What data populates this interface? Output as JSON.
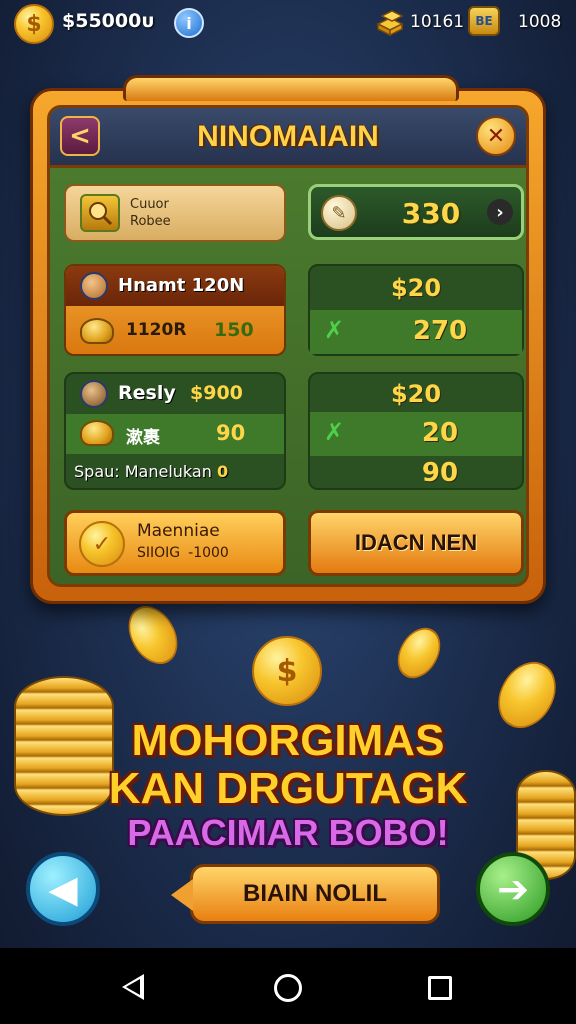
{
  "top_bar": {
    "coin_symbol": "$",
    "balance": "$55000ᴜ",
    "info_symbol": "i",
    "gold": "10161",
    "ticket_symbol": "BE",
    "tickets": "1008"
  },
  "panel": {
    "title": "NINOMAIAIN",
    "back_symbol": "<",
    "close_symbol": "✕",
    "item_row": {
      "line1": "Cuuor",
      "line2": "Robee"
    },
    "price_button": {
      "value": "330",
      "arrow": "›"
    },
    "offer1": {
      "title": "Hnamt 120N",
      "label": "1120R",
      "value": "150"
    },
    "reward1": {
      "top": "$20",
      "check": "✗",
      "value": "270"
    },
    "offer2": {
      "title": "Resly",
      "price": "$900",
      "label": "漱裹",
      "value": "90",
      "footer_prefix": "Spau:",
      "footer_text": "Manelukan",
      "footer_value": "0"
    },
    "reward2": {
      "top": "$20",
      "check": "✗",
      "value": "20",
      "bottom": "90"
    },
    "bottom_left": {
      "title": "Maenniae",
      "sub_left": "SIIOIG",
      "sub_right": "-1000"
    },
    "bottom_right_label": "IDACN NEN"
  },
  "headline": {
    "line1": "MOHORGIMAS",
    "line2": "KAN DRGUTAGK",
    "line3": "PAACIMAR BOBO!"
  },
  "bottom_controls": {
    "prev_symbol": "◀",
    "cta_label": "BIAIN NOLIL",
    "next_symbol": "➔"
  },
  "colors": {
    "accent_gold": "#ffd02a",
    "panel_green": "#3f6b2a",
    "headline_purple": "#d86ae8"
  }
}
